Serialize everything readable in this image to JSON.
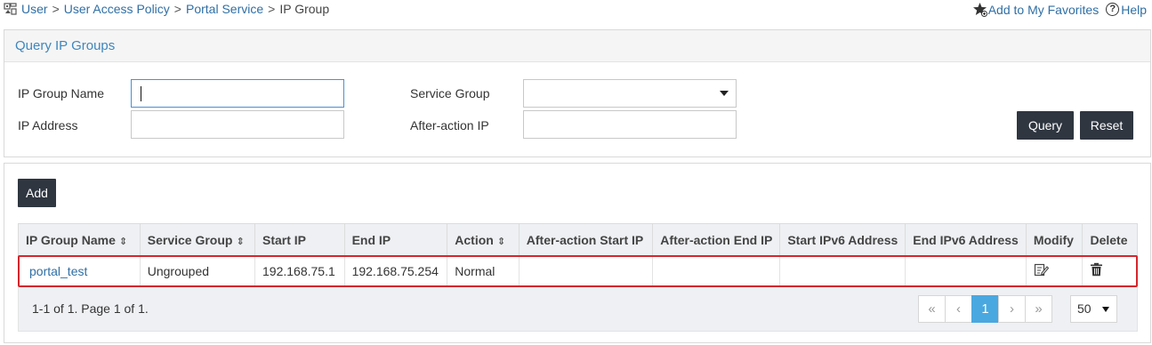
{
  "breadcrumb": {
    "items": [
      "User",
      "User Access Policy",
      "Portal Service"
    ],
    "current": "IP Group",
    "separator": ">"
  },
  "header_links": {
    "favorites": "Add to My Favorites",
    "help": "Help",
    "help_glyph": "?"
  },
  "query": {
    "title": "Query IP Groups",
    "ip_group_name_label": "IP Group Name",
    "ip_group_name_value": "",
    "ip_address_label": "IP Address",
    "ip_address_value": "",
    "service_group_label": "Service Group",
    "service_group_value": "",
    "after_action_ip_label": "After-action IP",
    "after_action_ip_value": "",
    "query_button": "Query",
    "reset_button": "Reset"
  },
  "list": {
    "add_button": "Add",
    "sort_glyph": "⇕",
    "columns": [
      "IP Group Name",
      "Service Group",
      "Start IP",
      "End IP",
      "Action",
      "After-action Start IP",
      "After-action End IP",
      "Start IPv6 Address",
      "End IPv6 Address",
      "Modify",
      "Delete"
    ],
    "sortable": [
      true,
      true,
      false,
      false,
      true,
      false,
      false,
      false,
      false,
      false,
      false
    ],
    "rows": [
      {
        "ip_group_name": "portal_test",
        "service_group": "Ungrouped",
        "start_ip": "192.168.75.1",
        "end_ip": "192.168.75.254",
        "action": "Normal",
        "after_action_start_ip": "",
        "after_action_end_ip": "",
        "start_ipv6": "",
        "end_ipv6": "",
        "modify_icon": "edit-icon",
        "delete_icon": "trash-icon"
      }
    ],
    "summary": "1-1 of 1. Page 1 of 1.",
    "pager": {
      "first": "«",
      "prev": "‹",
      "current": "1",
      "next": "›",
      "last": "»"
    },
    "page_size": "50"
  },
  "colors": {
    "link": "#2f6fa5",
    "title": "#3e86bd",
    "dark_button": "#2f3640",
    "highlight": "#d6262c",
    "active_page": "#4aa8e0"
  }
}
